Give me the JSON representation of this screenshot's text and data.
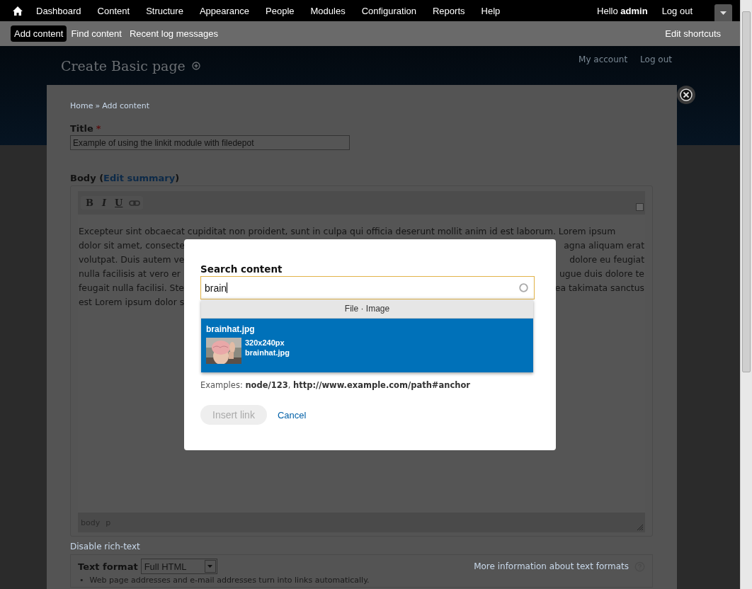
{
  "toolbar": {
    "items": [
      {
        "label": "Dashboard"
      },
      {
        "label": "Content"
      },
      {
        "label": "Structure"
      },
      {
        "label": "Appearance"
      },
      {
        "label": "People"
      },
      {
        "label": "Modules"
      },
      {
        "label": "Configuration"
      },
      {
        "label": "Reports"
      },
      {
        "label": "Help"
      }
    ],
    "greeting": "Hello **admin**",
    "logout": "Log out"
  },
  "shortcuts": {
    "items": [
      {
        "label": "Add content",
        "selected": true
      },
      {
        "label": "Find content",
        "selected": false
      },
      {
        "label": "Recent log messages",
        "selected": false
      }
    ],
    "edit": "Edit shortcuts"
  },
  "header": {
    "page_title": "Create Basic page",
    "links": [
      "My account",
      "Log out"
    ]
  },
  "breadcrumb": {
    "items": [
      "Home",
      "Add content"
    ],
    "separator": "»"
  },
  "form": {
    "title_label": "Title",
    "required_mark": "*",
    "title_value": "Example of using the linkit module with filedepot",
    "body_label": "Body (",
    "summary_link": "Edit summary",
    "body_label_end": ")",
    "editor": {
      "buttons": [
        {
          "label": "B",
          "kind": "bold"
        },
        {
          "label": "I",
          "kind": "italic"
        },
        {
          "label": "U",
          "kind": "underline"
        },
        {
          "kind": "link"
        }
      ],
      "lines": [
        {
          "left": "Excepteur sint obcaecat cupiditat non proident, sunt in culpa qui officia deserunt mollit anim id est laborum. Lorem ipsum"
        },
        {
          "left": "dolor sit amet, consecte",
          "right": "agna aliquam erat"
        },
        {
          "left": "volutpat. Duis autem ve",
          "right": "dolore eu feugiat"
        },
        {
          "left": "nulla facilisis at vero er",
          "right": "ugue duis dolore te"
        },
        {
          "left": "feugait nulla facilisi. Ste",
          "right": "ea takimata sanctus"
        },
        {
          "left": "est Lorem ipsum dolor s"
        }
      ],
      "path": [
        "body",
        "p"
      ]
    },
    "disable_link": "Disable rich-text",
    "format_label": "Text format",
    "format_value": "Full HTML",
    "format_help": "More information about text formats",
    "tips": [
      {
        "marker": "•",
        "text": "Web page addresses and e-mail addresses turn into links automatically."
      }
    ]
  },
  "dialog": {
    "label": "Search content",
    "query": "brain",
    "group": "File · Image",
    "results": [
      {
        "title": "brainhat.jpg",
        "size": "320x240px",
        "file": "brainhat.jpg",
        "selected": true
      }
    ],
    "examples": "Examples: **node/123**, **http://www.example.com/path#anchor**",
    "insert": "Insert link",
    "insert_disabled": true,
    "cancel": "Cancel"
  }
}
